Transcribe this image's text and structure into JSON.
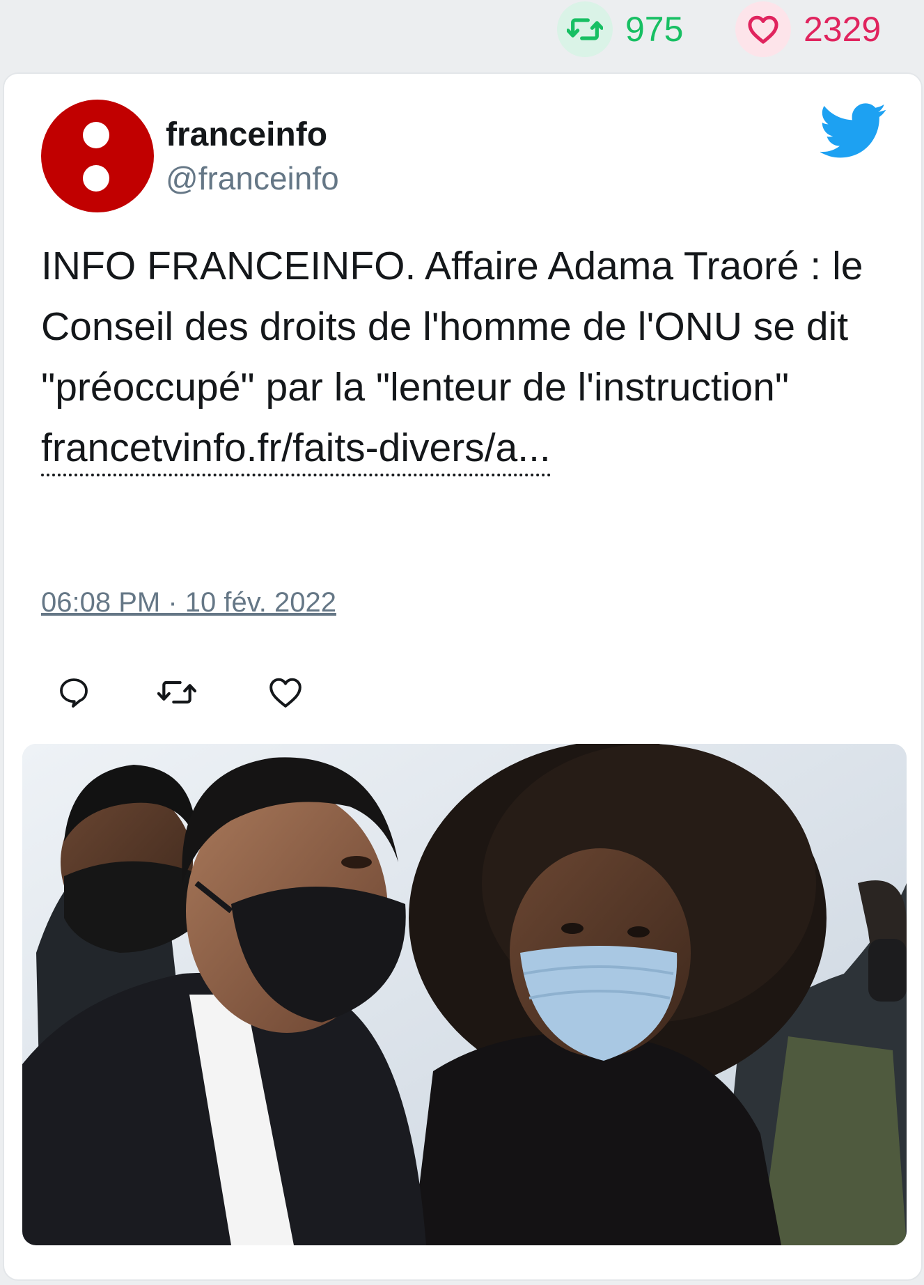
{
  "stats": {
    "retweets": "975",
    "likes": "2329",
    "retweet_color": "#17bf63",
    "like_color": "#e0245e"
  },
  "tweet": {
    "display_name": "franceinfo",
    "handle": "@franceinfo",
    "text": "INFO FRANCEINFO. Affaire Adama Traoré : le Conseil des droits de l'homme de l'ONU se dit \"préoccupé\" par la \"lenteur de l'instruction\"",
    "link_text": "francetvinfo.fr/faits-divers/a...",
    "timestamp": "06:08 PM · 10 fév. 2022",
    "avatar_color": "#c10000",
    "brand_icon": "twitter-bird-icon",
    "brand_color": "#1da1f2"
  },
  "actions": {
    "reply_icon": "reply-icon",
    "retweet_icon": "retweet-icon",
    "like_icon": "like-icon"
  }
}
